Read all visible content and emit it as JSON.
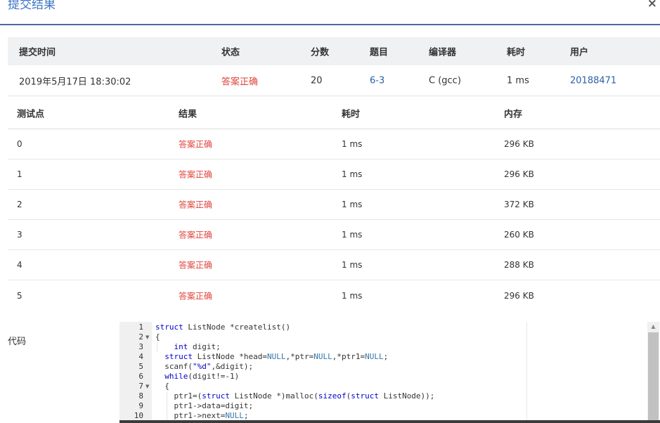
{
  "modal": {
    "title": "提交结果",
    "close_label": "×"
  },
  "summary": {
    "headers": [
      "提交时间",
      "状态",
      "分数",
      "题目",
      "编译器",
      "耗时",
      "用户"
    ],
    "row": {
      "time": "2019年5月17日 18:30:02",
      "status": "答案正确",
      "score": "20",
      "problem": "6-3",
      "compiler": "C (gcc)",
      "elapsed": "1 ms",
      "user": "20188471"
    }
  },
  "points": {
    "headers": [
      "测试点",
      "结果",
      "耗时",
      "内存"
    ],
    "rows": [
      {
        "id": "0",
        "result": "答案正确",
        "time": "1 ms",
        "memory": "296 KB"
      },
      {
        "id": "1",
        "result": "答案正确",
        "time": "1 ms",
        "memory": "296 KB"
      },
      {
        "id": "2",
        "result": "答案正确",
        "time": "1 ms",
        "memory": "372 KB"
      },
      {
        "id": "3",
        "result": "答案正确",
        "time": "1 ms",
        "memory": "260 KB"
      },
      {
        "id": "4",
        "result": "答案正确",
        "time": "1 ms",
        "memory": "288 KB"
      },
      {
        "id": "5",
        "result": "答案正确",
        "time": "1 ms",
        "memory": "296 KB"
      }
    ]
  },
  "code": {
    "label": "代码",
    "lines": [
      "struct ListNode *createlist()",
      "{",
      "    int digit;",
      "  struct ListNode *head=NULL,*ptr=NULL,*ptr1=NULL;",
      "  scanf(\"%d\",&digit);",
      "  while(digit!=-1)",
      "  {",
      "    ptr1=(struct ListNode *)malloc(sizeof(struct ListNode));",
      "    ptr1->data=digit;",
      "    ptr1->next=NULL;"
    ],
    "line_numbers": [
      "1",
      "2",
      "3",
      "4",
      "5",
      "6",
      "7",
      "8",
      "9",
      "10"
    ]
  },
  "colors": {
    "accent": "#3a74c4",
    "success": "#e0443c",
    "link": "#2a5fa8"
  }
}
